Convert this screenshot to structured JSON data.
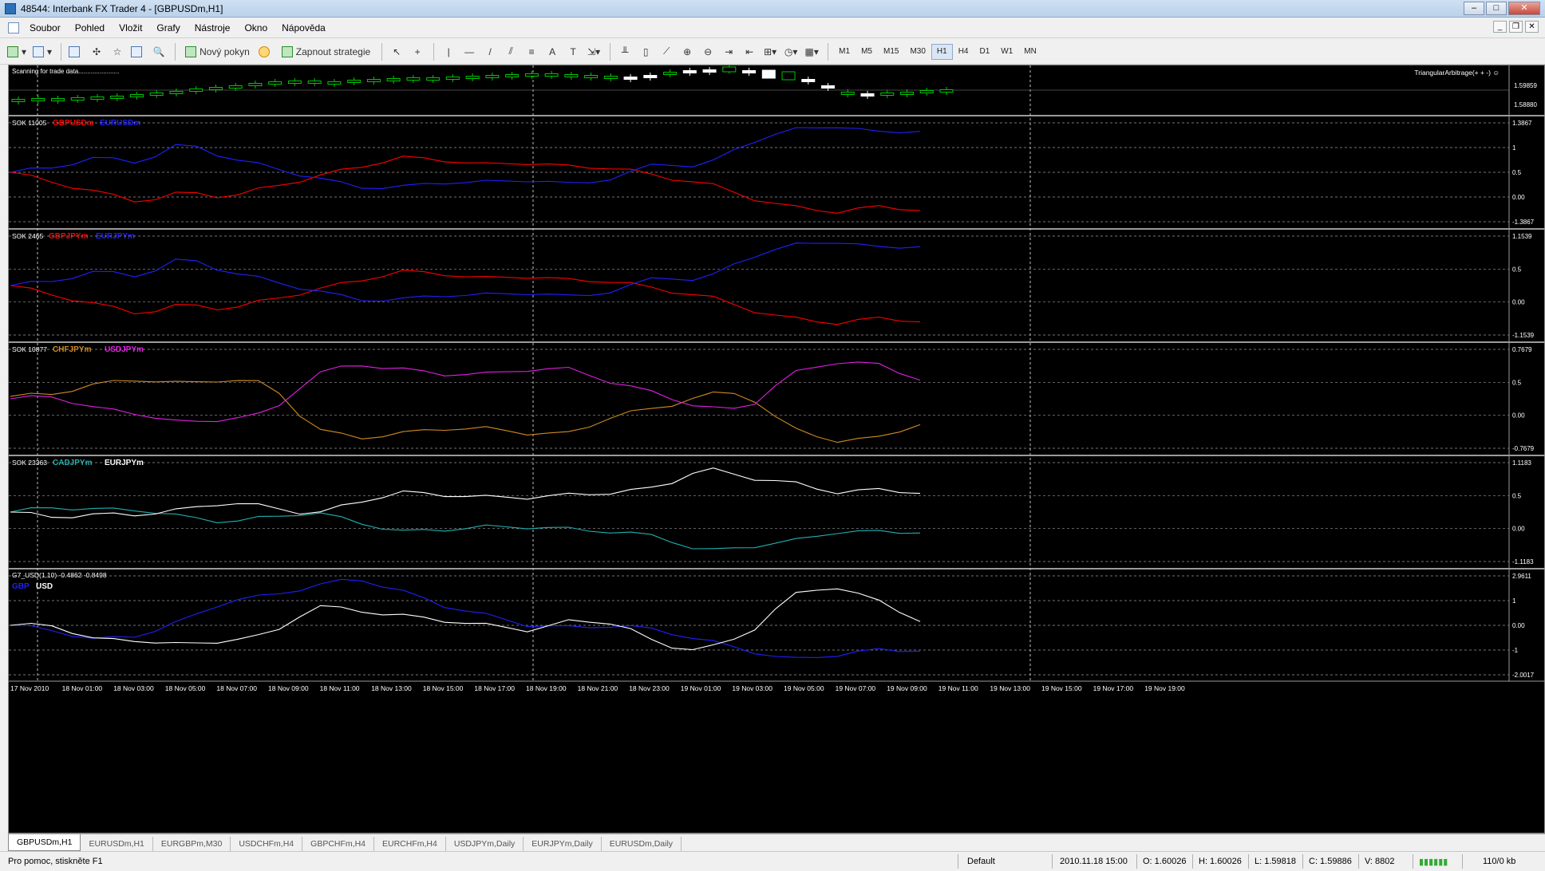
{
  "window": {
    "title": "48544: Interbank FX Trader 4 - [GBPUSDm,H1]"
  },
  "menu": {
    "items": [
      "Soubor",
      "Pohled",
      "Vložit",
      "Grafy",
      "Nástroje",
      "Okno",
      "Nápověda"
    ]
  },
  "toolbar": {
    "new_order_label": "Nový pokyn",
    "strategy_label": "Zapnout strategie",
    "timeframes": [
      "M1",
      "M5",
      "M15",
      "M30",
      "H1",
      "H4",
      "D1",
      "W1",
      "MN"
    ],
    "active_timeframe": "H1"
  },
  "chart": {
    "main": {
      "status_text": "Scanning for trade data.......................",
      "expert_label": "TriangularArbitrage(+ + -) ☺",
      "price_high": "1.59859",
      "price_low": "1.58880",
      "bull_color": "#00c800",
      "bear_color": "#ffffff"
    },
    "sub1": {
      "label": "SOK 11005",
      "series": [
        {
          "name": "GBPUSDm",
          "color": "#ff0000"
        },
        {
          "name": "EURUSDm",
          "color": "#2020ff"
        }
      ],
      "scale": [
        "1.3867",
        "1",
        "0.5",
        "0.00",
        "-1.3867"
      ]
    },
    "sub2": {
      "label": "SOK 2465",
      "series": [
        {
          "name": "GBPJPYm",
          "color": "#ff0000"
        },
        {
          "name": "EURJPYm",
          "color": "#2020ff"
        }
      ],
      "scale": [
        "1.1539",
        "0.5",
        "0.00",
        "-1.1539"
      ]
    },
    "sub3": {
      "label": "SOK 10877",
      "series": [
        {
          "name": "CHFJPYm",
          "color": "#d08a20"
        },
        {
          "name": "USDJPYm",
          "color": "#e020e0"
        }
      ],
      "scale": [
        "0.7679",
        "0.5",
        "0.00",
        "-0.7679"
      ]
    },
    "sub4": {
      "label": "SOK 23363",
      "series": [
        {
          "name": "CADJPYm",
          "color": "#20b0b0"
        },
        {
          "name": "EURJPYm",
          "color": "#ffffff"
        }
      ],
      "scale": [
        "1.1183",
        "0.5",
        "0.00",
        "-1.1183"
      ]
    },
    "sub5": {
      "label": "G7_USD(1,10) -0.4862 -0.8498",
      "series": [
        {
          "name": "GBP",
          "color": "#2020ff"
        },
        {
          "name": "USD",
          "color": "#ffffff"
        }
      ],
      "scale": [
        "2.9611",
        "1",
        "0.00",
        "-1",
        "-2.0017"
      ]
    },
    "time_labels": [
      "17 Nov 2010",
      "18 Nov 01:00",
      "18 Nov 03:00",
      "18 Nov 05:00",
      "18 Nov 07:00",
      "18 Nov 09:00",
      "18 Nov 11:00",
      "18 Nov 13:00",
      "18 Nov 15:00",
      "18 Nov 17:00",
      "18 Nov 19:00",
      "18 Nov 21:00",
      "18 Nov 23:00",
      "19 Nov 01:00",
      "19 Nov 03:00",
      "19 Nov 05:00",
      "19 Nov 07:00",
      "19 Nov 09:00",
      "19 Nov 11:00",
      "19 Nov 13:00",
      "19 Nov 15:00",
      "19 Nov 17:00",
      "19 Nov 19:00"
    ]
  },
  "tabs": [
    "GBPUSDm,H1",
    "EURUSDm,H1",
    "EURGBPm,M30",
    "USDCHFm,H4",
    "GBPCHFm,H4",
    "EURCHFm,H4",
    "USDJPYm,Daily",
    "EURJPYm,Daily",
    "EURUSDm,Daily"
  ],
  "active_tab": "GBPUSDm,H1",
  "status": {
    "help": "Pro pomoc, stiskněte F1",
    "profile": "Default",
    "datetime": "2010.11.18 15:00",
    "open": "O: 1.60026",
    "high": "H: 1.60026",
    "low": "L: 1.59818",
    "close": "C: 1.59886",
    "volume": "V: 8802",
    "traffic": "110/0 kb"
  }
}
